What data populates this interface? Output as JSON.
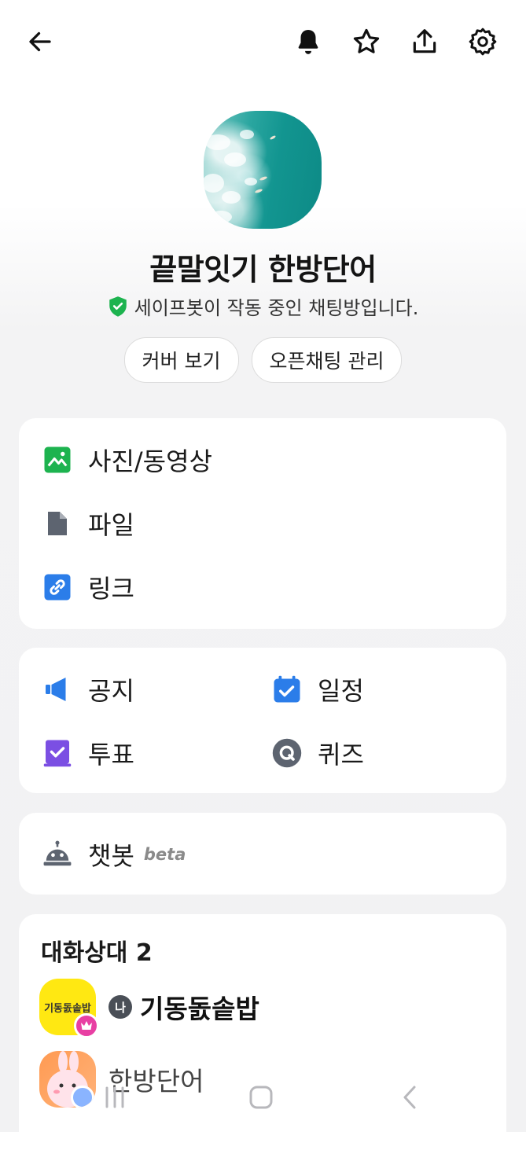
{
  "header": {
    "back_icon": "arrow-left-icon",
    "actions": [
      "bell-icon",
      "star-icon",
      "share-icon",
      "settings-icon"
    ]
  },
  "room": {
    "title": "끝말잇기 한방단어",
    "safebot_text": "세이프봇이 작동 중인 채팅방입니다.",
    "view_cover_label": "커버 보기",
    "manage_label": "오픈채팅 관리"
  },
  "media": {
    "photos_label": "사진/동영상",
    "files_label": "파일",
    "links_label": "링크"
  },
  "tools": {
    "notice_label": "공지",
    "schedule_label": "일정",
    "vote_label": "투표",
    "quiz_label": "퀴즈"
  },
  "chatbot": {
    "label": "챗봇",
    "badge": "beta"
  },
  "members": {
    "header": "대화상대 2",
    "list": [
      {
        "avatar_text": "기동돐솥밥",
        "me_badge": "나",
        "name": "기동돐솥밥"
      },
      {
        "avatar_text": "",
        "name": "한방단어"
      }
    ]
  },
  "colors": {
    "green": "#1db34f",
    "blue": "#2b7de9",
    "purple": "#7b4fe3",
    "gray_icon": "#5d6470",
    "yellow": "#ffe812",
    "pink": "#e83fa3"
  }
}
